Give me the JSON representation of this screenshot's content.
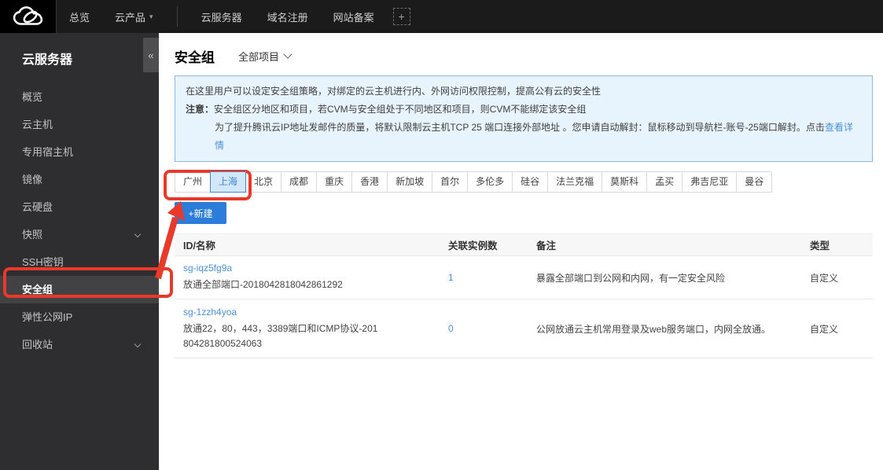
{
  "topbar": {
    "logo_name": "tencent-cloud-logo",
    "nav_left": [
      {
        "label": "总览"
      },
      {
        "label": "云产品"
      }
    ],
    "nav_right": [
      {
        "label": "云服务器"
      },
      {
        "label": "域名注册"
      },
      {
        "label": "网站备案"
      }
    ],
    "plus_label": "+"
  },
  "sidebar": {
    "title": "云服务器",
    "collapse_glyph": "«",
    "items": [
      {
        "label": "概览"
      },
      {
        "label": "云主机"
      },
      {
        "label": "专用宿主机"
      },
      {
        "label": "镜像"
      },
      {
        "label": "云硬盘"
      },
      {
        "label": "快照"
      },
      {
        "label": "SSH密钥"
      },
      {
        "label": "安全组"
      },
      {
        "label": "弹性公网IP"
      },
      {
        "label": "回收站"
      }
    ],
    "selected_item": "安全组"
  },
  "page": {
    "title": "安全组",
    "project_filter": "全部项目",
    "notice": {
      "line1": "在这里用户可以设定安全组策略，对绑定的云主机进行内、外网访问权限控制，提高公有云的安全性",
      "line2_label": "注意：",
      "line2": "安全组区分地区和项目，若CVM与安全组处于不同地区和项目，则CVM不能绑定该安全组",
      "line3": "为了提升腾讯云IP地址发邮件的质量，将默认限制云主机TCP 25 端口连接外部地址 。您申请自动解封：鼠标移动到导航栏-账号-25端口解封。点击",
      "line3_link": "查看详情"
    },
    "regions": {
      "selected": "上海",
      "items": [
        "广州",
        "上海",
        "北京",
        "成都",
        "重庆",
        "香港",
        "新加坡",
        "首尔",
        "多伦多",
        "硅谷",
        "法兰克福",
        "莫斯科",
        "孟买",
        "弗吉尼亚",
        "曼谷"
      ]
    },
    "new_button_label": "+新建",
    "table": {
      "headers": [
        "ID/名称",
        "关联实例数",
        "备注",
        "类型"
      ],
      "rows": [
        {
          "id": "sg-iqz5fg9a",
          "name": "放通全部端口-2018042818042861292",
          "instances": "1",
          "remark": "暴露全部端口到公网和内网，有一定安全风险",
          "type": "自定义"
        },
        {
          "id": "sg-1zzh4yoa",
          "name": "放通22，80，443，3389端口和ICMP协议-201804281800524063",
          "instances": "0",
          "remark": "公网放通云主机常用登录及web服务端口，内网全放通。",
          "type": "自定义"
        }
      ]
    }
  },
  "colors": {
    "accent_blue": "#3e87d8",
    "link_blue": "#4a90d9",
    "button_blue": "#2b7dd9",
    "notice_bg": "#e8f4fd",
    "notice_border": "#8db9e0",
    "annotation_red": "#e8392b",
    "topbar_bg": "#1b1b1b",
    "sidebar_bg": "#2e2e30"
  }
}
